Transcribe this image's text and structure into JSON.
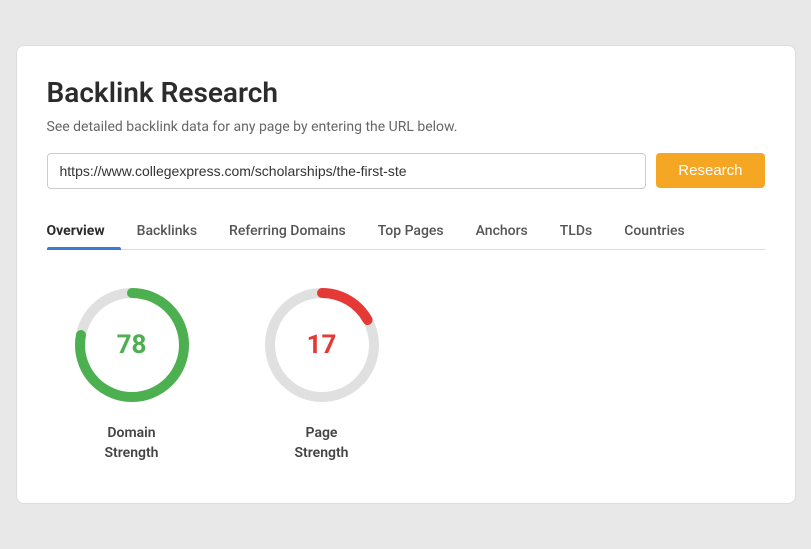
{
  "page": {
    "title": "Backlink Research",
    "subtitle": "See detailed backlink data for any page by entering the URL below."
  },
  "search": {
    "url_value": "https://www.collegexpress.com/scholarships/the-first-ste",
    "button_label": "Research"
  },
  "tabs": [
    {
      "id": "overview",
      "label": "Overview",
      "active": true
    },
    {
      "id": "backlinks",
      "label": "Backlinks",
      "active": false
    },
    {
      "id": "referring-domains",
      "label": "Referring Domains",
      "active": false
    },
    {
      "id": "top-pages",
      "label": "Top Pages",
      "active": false
    },
    {
      "id": "anchors",
      "label": "Anchors",
      "active": false
    },
    {
      "id": "tlds",
      "label": "TLDs",
      "active": false
    },
    {
      "id": "countries",
      "label": "Countries",
      "active": false
    }
  ],
  "gauges": [
    {
      "id": "domain-strength",
      "value": "78",
      "label": "Domain\nStrength",
      "color": "green",
      "color_hex": "#4caf50",
      "track_color": "#e0e0e0",
      "percent": 78
    },
    {
      "id": "page-strength",
      "value": "17",
      "label": "Page\nStrength",
      "color": "red",
      "color_hex": "#e53935",
      "track_color": "#e0e0e0",
      "percent": 17
    }
  ]
}
